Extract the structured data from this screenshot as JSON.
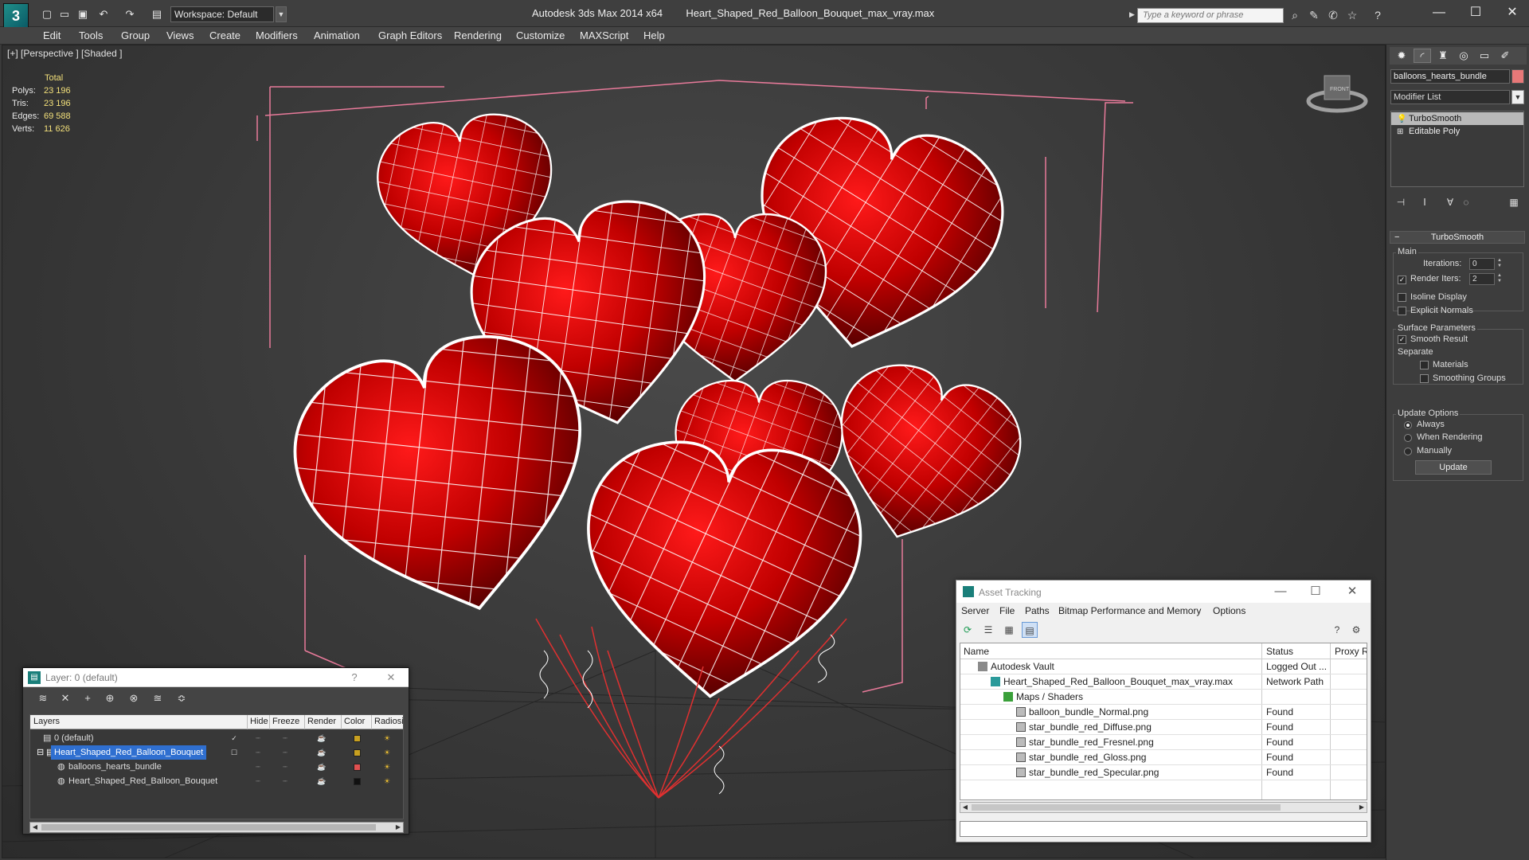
{
  "titlebar": {
    "workspace": "Workspace: Default",
    "app": "Autodesk 3ds Max  2014 x64",
    "file": "Heart_Shaped_Red_Balloon_Bouquet_max_vray.max",
    "search_placeholder": "Type a keyword or phrase"
  },
  "menu": [
    "Edit",
    "Tools",
    "Group",
    "Views",
    "Create",
    "Modifiers",
    "Animation",
    "Graph Editors",
    "Rendering",
    "Customize",
    "MAXScript",
    "Help"
  ],
  "viewport": {
    "label": "[+] [Perspective ] [Shaded ]",
    "stats": {
      "header": "Total",
      "rows": [
        {
          "label": "Polys:",
          "value": "23 196"
        },
        {
          "label": "Tris:",
          "value": "23 196"
        },
        {
          "label": "Edges:",
          "value": "69 588"
        },
        {
          "label": "Verts:",
          "value": "11 626"
        }
      ]
    },
    "viewcube_label": "FRONT"
  },
  "command_panel": {
    "object_name": "balloons_hearts_bundle",
    "modifier_list": "Modifier List",
    "stack": [
      "TurboSmooth",
      "Editable Poly"
    ],
    "rollout_title": "TurboSmooth",
    "main_group": "Main",
    "iterations_label": "Iterations:",
    "iterations_value": "0",
    "render_iters_label": "Render Iters:",
    "render_iters_value": "2",
    "isoline": "Isoline Display",
    "explicit_normals": "Explicit Normals",
    "surface_group": "Surface Parameters",
    "smooth_result": "Smooth Result",
    "separate": "Separate",
    "materials": "Materials",
    "smoothing_groups": "Smoothing Groups",
    "update_group": "Update Options",
    "always": "Always",
    "when_rendering": "When Rendering",
    "manually": "Manually",
    "update_button": "Update"
  },
  "layer_dialog": {
    "title": "Layer: 0 (default)",
    "help": "?",
    "columns": [
      "Layers",
      "Hide",
      "Freeze",
      "Render",
      "Color",
      "Radiosi"
    ],
    "rows": [
      {
        "name": "0 (default)",
        "color": "#c8a020",
        "level": 0
      },
      {
        "name": "Heart_Shaped_Red_Balloon_Bouquet",
        "color": "#c8a020",
        "level": 0
      },
      {
        "name": "balloons_hearts_bundle",
        "color": "#e05050",
        "level": 1
      },
      {
        "name": "Heart_Shaped_Red_Balloon_Bouquet",
        "color": "#111111",
        "level": 1
      }
    ]
  },
  "asset_dialog": {
    "title": "Asset Tracking",
    "menus": [
      "Server",
      "File",
      "Paths",
      "Bitmap Performance and Memory",
      "Options"
    ],
    "columns": [
      "Name",
      "Status",
      "Proxy Re"
    ],
    "rows": [
      {
        "name": "Autodesk Vault",
        "status": "Logged Out ...",
        "indent": 0
      },
      {
        "name": "Heart_Shaped_Red_Balloon_Bouquet_max_vray.max",
        "status": "Network Path",
        "indent": 1
      },
      {
        "name": "Maps / Shaders",
        "status": "",
        "indent": 2
      },
      {
        "name": "balloon_bundle_Normal.png",
        "status": "Found",
        "indent": 3
      },
      {
        "name": "star_bundle_red_Diffuse.png",
        "status": "Found",
        "indent": 3
      },
      {
        "name": "star_bundle_red_Fresnel.png",
        "status": "Found",
        "indent": 3
      },
      {
        "name": "star_bundle_red_Gloss.png",
        "status": "Found",
        "indent": 3
      },
      {
        "name": "star_bundle_red_Specular.png",
        "status": "Found",
        "indent": 3
      }
    ]
  },
  "colors": {
    "balloon_red": "#c40000",
    "wire_white": "#ffffff",
    "bbox_pink": "#e87a9a",
    "selection_blue": "#2f6fd0"
  }
}
